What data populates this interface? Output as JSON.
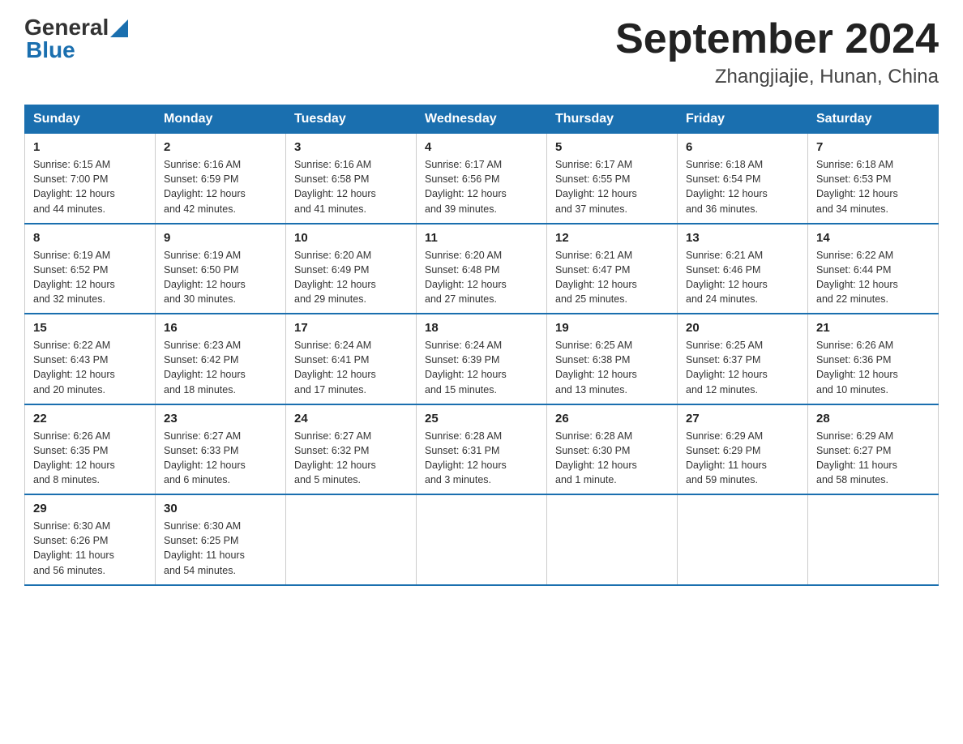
{
  "header": {
    "logo_general": "General",
    "logo_blue": "Blue",
    "title": "September 2024",
    "subtitle": "Zhangjiajie, Hunan, China"
  },
  "weekdays": [
    "Sunday",
    "Monday",
    "Tuesday",
    "Wednesday",
    "Thursday",
    "Friday",
    "Saturday"
  ],
  "weeks": [
    [
      {
        "day": "1",
        "info": "Sunrise: 6:15 AM\nSunset: 7:00 PM\nDaylight: 12 hours\nand 44 minutes."
      },
      {
        "day": "2",
        "info": "Sunrise: 6:16 AM\nSunset: 6:59 PM\nDaylight: 12 hours\nand 42 minutes."
      },
      {
        "day": "3",
        "info": "Sunrise: 6:16 AM\nSunset: 6:58 PM\nDaylight: 12 hours\nand 41 minutes."
      },
      {
        "day": "4",
        "info": "Sunrise: 6:17 AM\nSunset: 6:56 PM\nDaylight: 12 hours\nand 39 minutes."
      },
      {
        "day": "5",
        "info": "Sunrise: 6:17 AM\nSunset: 6:55 PM\nDaylight: 12 hours\nand 37 minutes."
      },
      {
        "day": "6",
        "info": "Sunrise: 6:18 AM\nSunset: 6:54 PM\nDaylight: 12 hours\nand 36 minutes."
      },
      {
        "day": "7",
        "info": "Sunrise: 6:18 AM\nSunset: 6:53 PM\nDaylight: 12 hours\nand 34 minutes."
      }
    ],
    [
      {
        "day": "8",
        "info": "Sunrise: 6:19 AM\nSunset: 6:52 PM\nDaylight: 12 hours\nand 32 minutes."
      },
      {
        "day": "9",
        "info": "Sunrise: 6:19 AM\nSunset: 6:50 PM\nDaylight: 12 hours\nand 30 minutes."
      },
      {
        "day": "10",
        "info": "Sunrise: 6:20 AM\nSunset: 6:49 PM\nDaylight: 12 hours\nand 29 minutes."
      },
      {
        "day": "11",
        "info": "Sunrise: 6:20 AM\nSunset: 6:48 PM\nDaylight: 12 hours\nand 27 minutes."
      },
      {
        "day": "12",
        "info": "Sunrise: 6:21 AM\nSunset: 6:47 PM\nDaylight: 12 hours\nand 25 minutes."
      },
      {
        "day": "13",
        "info": "Sunrise: 6:21 AM\nSunset: 6:46 PM\nDaylight: 12 hours\nand 24 minutes."
      },
      {
        "day": "14",
        "info": "Sunrise: 6:22 AM\nSunset: 6:44 PM\nDaylight: 12 hours\nand 22 minutes."
      }
    ],
    [
      {
        "day": "15",
        "info": "Sunrise: 6:22 AM\nSunset: 6:43 PM\nDaylight: 12 hours\nand 20 minutes."
      },
      {
        "day": "16",
        "info": "Sunrise: 6:23 AM\nSunset: 6:42 PM\nDaylight: 12 hours\nand 18 minutes."
      },
      {
        "day": "17",
        "info": "Sunrise: 6:24 AM\nSunset: 6:41 PM\nDaylight: 12 hours\nand 17 minutes."
      },
      {
        "day": "18",
        "info": "Sunrise: 6:24 AM\nSunset: 6:39 PM\nDaylight: 12 hours\nand 15 minutes."
      },
      {
        "day": "19",
        "info": "Sunrise: 6:25 AM\nSunset: 6:38 PM\nDaylight: 12 hours\nand 13 minutes."
      },
      {
        "day": "20",
        "info": "Sunrise: 6:25 AM\nSunset: 6:37 PM\nDaylight: 12 hours\nand 12 minutes."
      },
      {
        "day": "21",
        "info": "Sunrise: 6:26 AM\nSunset: 6:36 PM\nDaylight: 12 hours\nand 10 minutes."
      }
    ],
    [
      {
        "day": "22",
        "info": "Sunrise: 6:26 AM\nSunset: 6:35 PM\nDaylight: 12 hours\nand 8 minutes."
      },
      {
        "day": "23",
        "info": "Sunrise: 6:27 AM\nSunset: 6:33 PM\nDaylight: 12 hours\nand 6 minutes."
      },
      {
        "day": "24",
        "info": "Sunrise: 6:27 AM\nSunset: 6:32 PM\nDaylight: 12 hours\nand 5 minutes."
      },
      {
        "day": "25",
        "info": "Sunrise: 6:28 AM\nSunset: 6:31 PM\nDaylight: 12 hours\nand 3 minutes."
      },
      {
        "day": "26",
        "info": "Sunrise: 6:28 AM\nSunset: 6:30 PM\nDaylight: 12 hours\nand 1 minute."
      },
      {
        "day": "27",
        "info": "Sunrise: 6:29 AM\nSunset: 6:29 PM\nDaylight: 11 hours\nand 59 minutes."
      },
      {
        "day": "28",
        "info": "Sunrise: 6:29 AM\nSunset: 6:27 PM\nDaylight: 11 hours\nand 58 minutes."
      }
    ],
    [
      {
        "day": "29",
        "info": "Sunrise: 6:30 AM\nSunset: 6:26 PM\nDaylight: 11 hours\nand 56 minutes."
      },
      {
        "day": "30",
        "info": "Sunrise: 6:30 AM\nSunset: 6:25 PM\nDaylight: 11 hours\nand 54 minutes."
      },
      {
        "day": "",
        "info": ""
      },
      {
        "day": "",
        "info": ""
      },
      {
        "day": "",
        "info": ""
      },
      {
        "day": "",
        "info": ""
      },
      {
        "day": "",
        "info": ""
      }
    ]
  ]
}
